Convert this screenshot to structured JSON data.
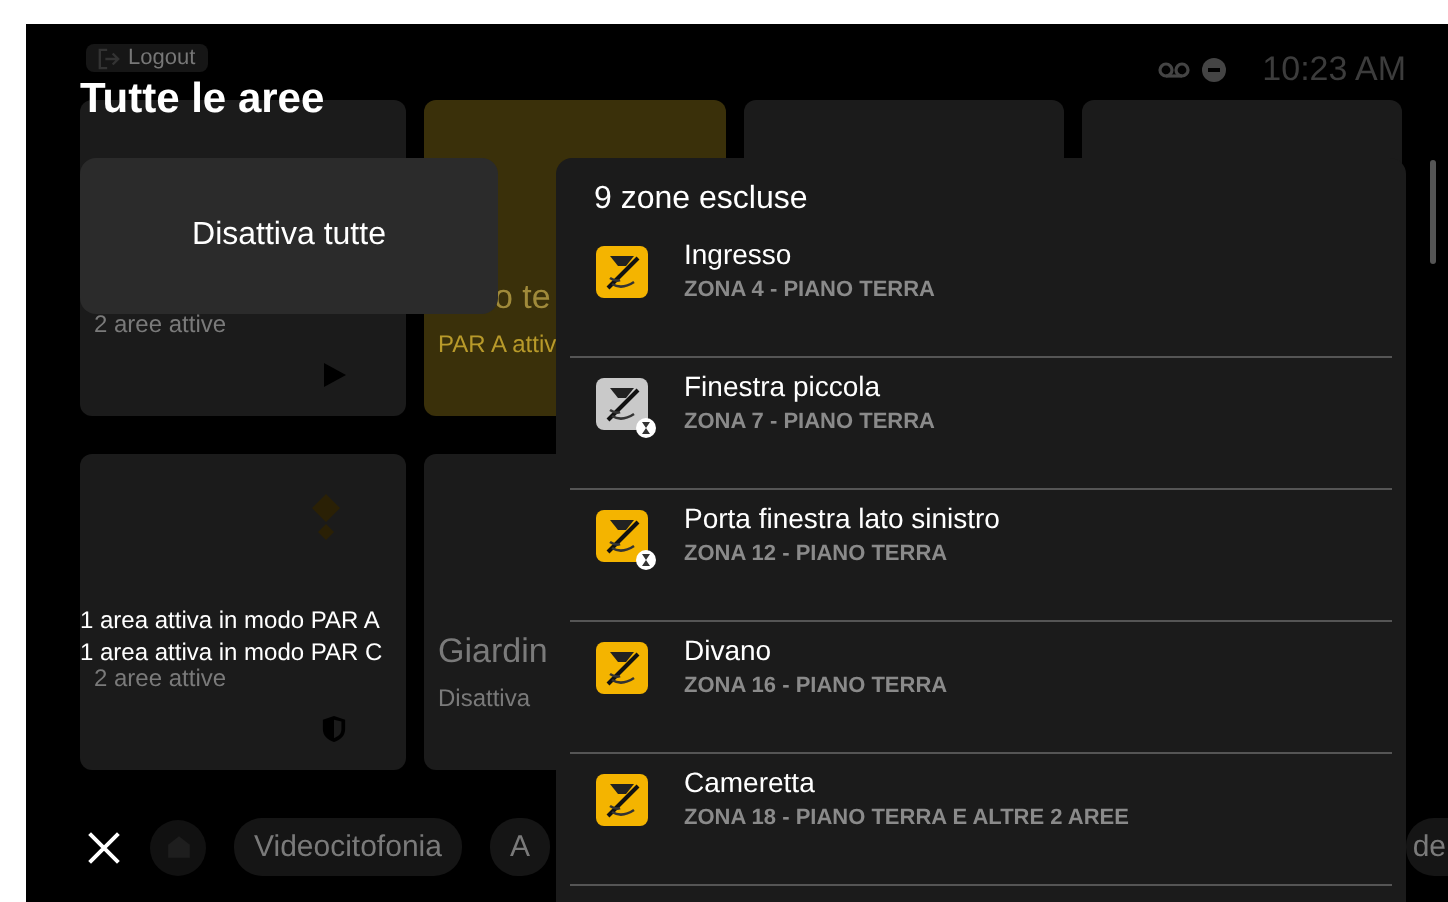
{
  "header": {
    "title": "Tutte le aree",
    "logout": "Logout",
    "time": "10:23 AM"
  },
  "background_cards": [
    {
      "kind": "plain",
      "subtitle": "2 aree attive"
    },
    {
      "kind": "armed",
      "title": "o te",
      "subtitle": "PAR A attiv"
    },
    {
      "kind": "plain"
    },
    {
      "kind": "plain"
    },
    {
      "kind": "plain",
      "subtitle": "2 aree attive"
    },
    {
      "kind": "plain",
      "title": "Giardin",
      "subtitle": "Disattiva"
    }
  ],
  "bottom_bar": {
    "pills": [
      "Videocitofonia",
      "A"
    ],
    "edge_text": "de"
  },
  "menu": {
    "action": "Disattiva tutte"
  },
  "tooltip": [
    "1 area attiva in modo PAR A",
    "1 area attiva in modo PAR C"
  ],
  "panel": {
    "title": "9 zone escluse",
    "zones": [
      {
        "name": "Ingresso",
        "detail": "ZONA 4 - PIANO TERRA",
        "kind": "alert",
        "timer": false
      },
      {
        "name": "Finestra piccola",
        "detail": "ZONA 7 - PIANO TERRA",
        "kind": "inactive",
        "timer": true
      },
      {
        "name": "Porta finestra lato sinistro",
        "detail": "ZONA 12 - PIANO TERRA",
        "kind": "alert",
        "timer": true
      },
      {
        "name": "Divano",
        "detail": "ZONA 16 - PIANO TERRA",
        "kind": "alert",
        "timer": false
      },
      {
        "name": "Cameretta",
        "detail": "ZONA 18 - PIANO TERRA  E ALTRE 2 AREE",
        "kind": "alert",
        "timer": false
      }
    ]
  }
}
